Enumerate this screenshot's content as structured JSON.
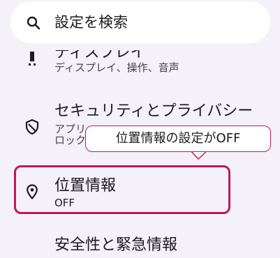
{
  "search": {
    "placeholder": "設定を検索",
    "icon": "search-icon"
  },
  "items": {
    "display": {
      "title": "ディスプレイ",
      "summary": "ディスプレイ、操作、音声",
      "icon": "display-icon"
    },
    "security": {
      "title": "セキュリティとプライバシー",
      "summary_line1": "アプリ",
      "summary_line2": "ロック",
      "icon": "shield-icon"
    },
    "location": {
      "title": "位置情報",
      "summary": "OFF",
      "icon": "location-pin-icon"
    },
    "safety": {
      "title": "安全性と緊急情報",
      "icon": "safety-icon"
    }
  },
  "tooltip": {
    "text": "位置情報の設定がOFF"
  },
  "colors": {
    "background": "#f4f1f8",
    "highlight": "#c2185b",
    "text": "#1c1b1f",
    "secondary_text": "#45424b"
  }
}
